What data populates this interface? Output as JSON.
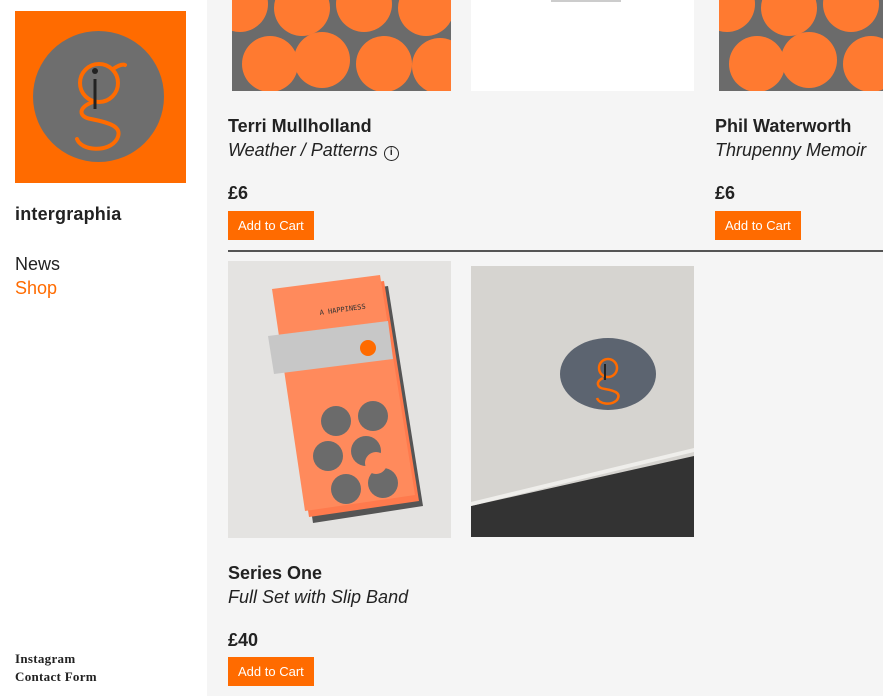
{
  "site": {
    "name": "intergraphia"
  },
  "nav": {
    "news": "News",
    "shop": "Shop"
  },
  "footer": {
    "instagram": "Instagram",
    "contact": "Contact Form"
  },
  "products": [
    {
      "author": "Terri Mullholland",
      "title": "Weather / Patterns",
      "price": "£6",
      "button": "Add to Cart"
    },
    {
      "author": "Phil Waterworth",
      "title": "Thrupenny Memoir",
      "price": "£6",
      "button": "Add to Cart"
    },
    {
      "author": "Series One",
      "title": "Full Set with Slip Band",
      "price": "£40",
      "button": "Add to Cart"
    }
  ],
  "colors": {
    "accent": "#ff6b00",
    "logo_grey": "#6e6e6e"
  },
  "icons": {
    "info": "info-icon",
    "logo": "intergraphia-logo"
  },
  "book_text": {
    "band": "A HAPPINESS"
  }
}
